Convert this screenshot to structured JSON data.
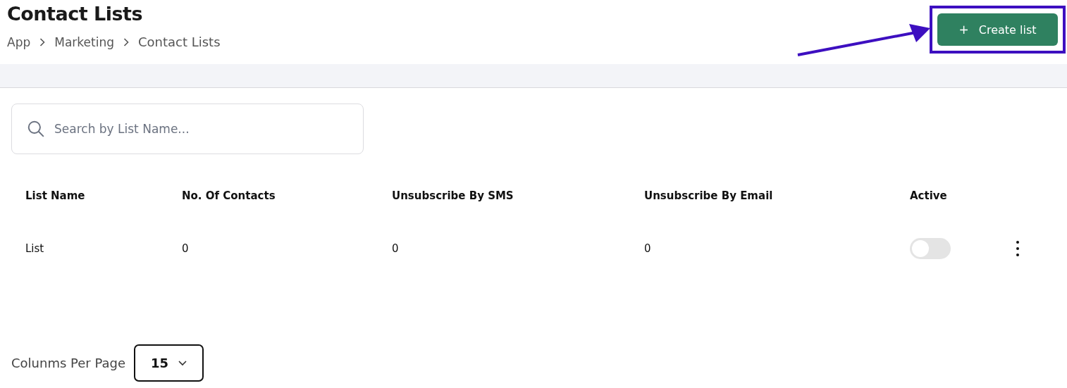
{
  "page": {
    "title": "Contact Lists"
  },
  "breadcrumb": [
    "App",
    "Marketing",
    "Contact Lists"
  ],
  "create_button": {
    "icon": "+",
    "label": "Create list",
    "highlighted": true
  },
  "search": {
    "placeholder": "Search by List Name..."
  },
  "table": {
    "columns": [
      "List Name",
      "No. Of Contacts",
      "Unsubscribe By SMS",
      "Unsubscribe By Email",
      "Active"
    ],
    "rows": [
      {
        "cells": [
          "List",
          "0",
          "0",
          "0"
        ],
        "active": false
      }
    ]
  },
  "pagination": {
    "label": "Colunms Per Page",
    "value": "15"
  }
}
